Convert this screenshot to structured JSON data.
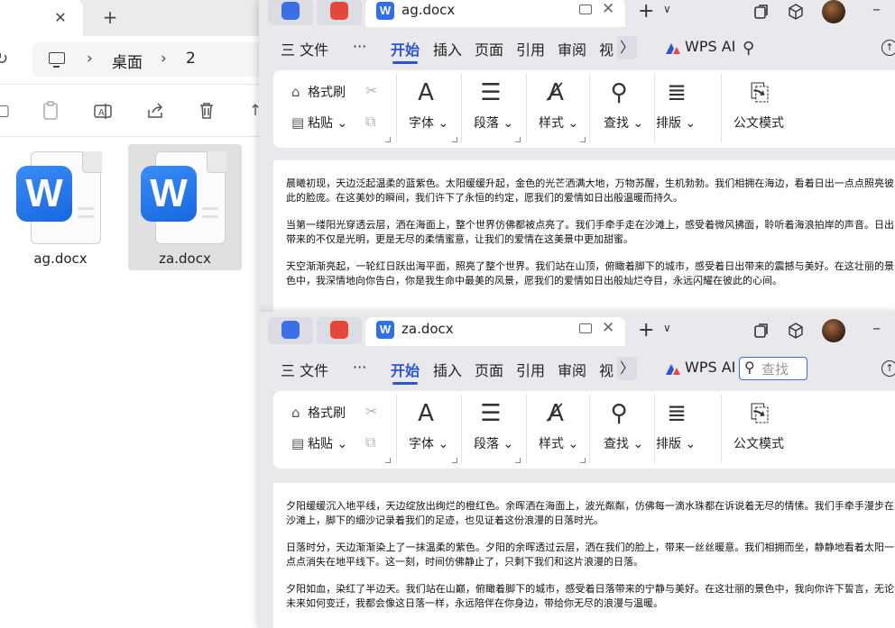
{
  "explorer": {
    "tab_close": "✕",
    "tab_new": "+",
    "breadcrumb": [
      "桌面",
      "2"
    ],
    "files": [
      {
        "name": "ag.docx",
        "selected": false
      },
      {
        "name": "za.docx",
        "selected": true
      }
    ]
  },
  "wps_windows": [
    {
      "doc_name": "ag.docx",
      "menu": {
        "file": "三 文件",
        "more": "···",
        "tabs": [
          "开始",
          "插入",
          "页面",
          "引用",
          "审阅",
          "视"
        ],
        "more_arrow": "〉",
        "wps_ai": "WPS AI",
        "search_placeholder": ""
      },
      "ribbon": {
        "format_painter": "格式刷",
        "paste": "粘贴",
        "font": "字体",
        "paragraph": "段落",
        "style": "样式",
        "find": "查找",
        "layout": "排版",
        "doc_mode": "公文模式"
      },
      "paragraphs": [
        "晨曦初现，天边泛起温柔的蓝紫色。太阳缓缓升起，金色的光芒洒满大地，万物苏醒，生机勃勃。我们相拥在海边，看着日出一点点照亮彼此的脸庞。在这美妙的瞬间，我们许下了永恒的约定，愿我们的爱情如日出般温暖而持久。",
        "当第一缕阳光穿透云层，洒在海面上，整个世界仿佛都被点亮了。我们手牵手走在沙滩上，感受着微风拂面，聆听着海浪拍岸的声音。日出带来的不仅是光明，更是无尽的柔情蜜意，让我们的爱情在这美景中更加甜蜜。",
        "天空渐渐亮起，一轮红日跃出海平面，照亮了整个世界。我们站在山顶，俯瞰着脚下的城市，感受着日出带来的震撼与美好。在这壮丽的景色中，我深情地向你告白，你是我生命中最美的风景，愿我们的爱情如日出般灿烂夺目，永远闪耀在彼此的心间。"
      ]
    },
    {
      "doc_name": "za.docx",
      "menu": {
        "file": "三 文件",
        "more": "···",
        "tabs": [
          "开始",
          "插入",
          "页面",
          "引用",
          "审阅",
          "视"
        ],
        "more_arrow": "〉",
        "wps_ai": "WPS AI",
        "search_placeholder": "查找"
      },
      "ribbon": {
        "format_painter": "格式刷",
        "paste": "粘贴",
        "font": "字体",
        "paragraph": "段落",
        "style": "样式",
        "find": "查找",
        "layout": "排版",
        "doc_mode": "公文模式"
      },
      "paragraphs": [
        "夕阳缓缓沉入地平线，天边绽放出绚烂的橙红色。余晖洒在海面上，波光粼粼，仿佛每一滴水珠都在诉说着无尽的情愫。我们手牵手漫步在沙滩上，脚下的细沙记录着我们的足迹，也见证着这份浪漫的日落时光。",
        "日落时分，天边渐渐染上了一抹温柔的紫色。夕阳的余晖透过云层，洒在我们的脸上，带来一丝丝暖意。我们相拥而坐，静静地看着太阳一点点消失在地平线下。这一刻，时间仿佛静止了，只剩下我们和这片浪漫的日落。",
        "夕阳如血，染红了半边天。我们站在山巅，俯瞰着脚下的城市，感受着日落带来的宁静与美好。在这壮丽的景色中，我向你许下誓言，无论未来如何变迁，我都会像这日落一样，永远陪伴在你身边，带给你无尽的浪漫与温暖。"
      ]
    }
  ],
  "colors": {
    "accent": "#2a56d6",
    "word_blue": "#2e6ff0",
    "wps_red": "#e5483b"
  }
}
